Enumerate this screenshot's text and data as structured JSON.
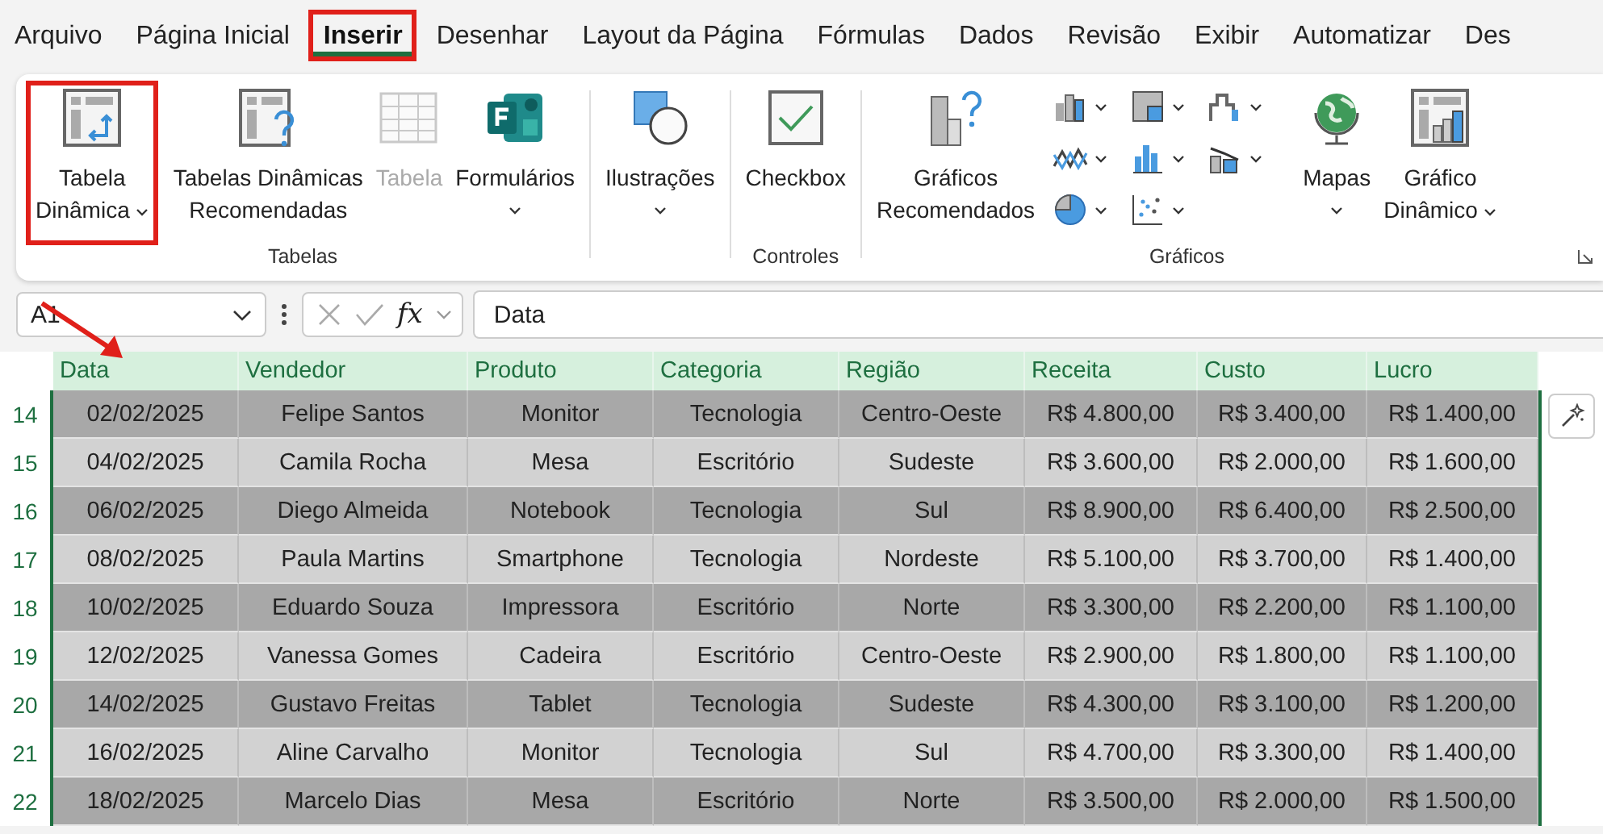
{
  "tabs": [
    {
      "label": "Arquivo",
      "selected": false,
      "highlighted": false
    },
    {
      "label": "Página Inicial",
      "selected": false,
      "highlighted": false
    },
    {
      "label": "Inserir",
      "selected": true,
      "highlighted": true
    },
    {
      "label": "Desenhar",
      "selected": false,
      "highlighted": false
    },
    {
      "label": "Layout da Página",
      "selected": false,
      "highlighted": false
    },
    {
      "label": "Fórmulas",
      "selected": false,
      "highlighted": false
    },
    {
      "label": "Dados",
      "selected": false,
      "highlighted": false
    },
    {
      "label": "Revisão",
      "selected": false,
      "highlighted": false
    },
    {
      "label": "Exibir",
      "selected": false,
      "highlighted": false
    },
    {
      "label": "Automatizar",
      "selected": false,
      "highlighted": false
    },
    {
      "label": "Des",
      "selected": false,
      "highlighted": false
    }
  ],
  "ribbon": {
    "groups": [
      {
        "label": "Tabelas",
        "buttons": [
          {
            "lines": [
              "Tabela",
              "Dinâmica"
            ],
            "dropdown": true,
            "disabled": false,
            "highlighted": true
          },
          {
            "lines": [
              "Tabelas Dinâmicas",
              "Recomendadas"
            ],
            "dropdown": false,
            "disabled": false,
            "highlighted": false
          },
          {
            "lines": [
              "Tabela"
            ],
            "dropdown": false,
            "disabled": true,
            "highlighted": false
          },
          {
            "lines": [
              "Formulários"
            ],
            "dropdown": true,
            "disabled": false,
            "highlighted": false
          }
        ]
      },
      {
        "buttons": [
          {
            "lines": [
              "Ilustrações"
            ],
            "dropdown": true,
            "disabled": false,
            "highlighted": false
          }
        ]
      },
      {
        "label": "Controles",
        "buttons": [
          {
            "lines": [
              "Checkbox"
            ],
            "dropdown": false,
            "disabled": false,
            "highlighted": false
          }
        ]
      },
      {
        "label": "Gráficos",
        "buttons": [
          {
            "lines": [
              "Gráficos",
              "Recomendados"
            ],
            "dropdown": false,
            "disabled": false,
            "highlighted": false
          },
          {
            "lines": [
              "Mapas"
            ],
            "dropdown": true,
            "disabled": false,
            "highlighted": false
          },
          {
            "lines": [
              "Gráfico",
              "Dinâmico"
            ],
            "dropdown": true,
            "disabled": false,
            "highlighted": false
          }
        ]
      }
    ]
  },
  "formula_bar": {
    "name_box": "A1",
    "fx": "fx",
    "value": "Data"
  },
  "table": {
    "columns": [
      "Data",
      "Vendedor",
      "Produto",
      "Categoria",
      "Região",
      "Receita",
      "Custo",
      "Lucro"
    ],
    "rows": [
      {
        "number": "14",
        "shaded": true,
        "cells": [
          "02/02/2025",
          "Felipe Santos",
          "Monitor",
          "Tecnologia",
          "Centro-Oeste",
          "R$ 4.800,00",
          "R$ 3.400,00",
          "R$ 1.400,00"
        ]
      },
      {
        "number": "15",
        "shaded": false,
        "cells": [
          "04/02/2025",
          "Camila Rocha",
          "Mesa",
          "Escritório",
          "Sudeste",
          "R$ 3.600,00",
          "R$ 2.000,00",
          "R$ 1.600,00"
        ]
      },
      {
        "number": "16",
        "shaded": true,
        "cells": [
          "06/02/2025",
          "Diego Almeida",
          "Notebook",
          "Tecnologia",
          "Sul",
          "R$ 8.900,00",
          "R$ 6.400,00",
          "R$ 2.500,00"
        ]
      },
      {
        "number": "17",
        "shaded": false,
        "cells": [
          "08/02/2025",
          "Paula Martins",
          "Smartphone",
          "Tecnologia",
          "Nordeste",
          "R$ 5.100,00",
          "R$ 3.700,00",
          "R$ 1.400,00"
        ]
      },
      {
        "number": "18",
        "shaded": true,
        "cells": [
          "10/02/2025",
          "Eduardo Souza",
          "Impressora",
          "Escritório",
          "Norte",
          "R$ 3.300,00",
          "R$ 2.200,00",
          "R$ 1.100,00"
        ]
      },
      {
        "number": "19",
        "shaded": false,
        "cells": [
          "12/02/2025",
          "Vanessa Gomes",
          "Cadeira",
          "Escritório",
          "Centro-Oeste",
          "R$ 2.900,00",
          "R$ 1.800,00",
          "R$ 1.100,00"
        ]
      },
      {
        "number": "20",
        "shaded": true,
        "cells": [
          "14/02/2025",
          "Gustavo Freitas",
          "Tablet",
          "Tecnologia",
          "Sudeste",
          "R$ 4.300,00",
          "R$ 3.100,00",
          "R$ 1.200,00"
        ]
      },
      {
        "number": "21",
        "shaded": false,
        "cells": [
          "16/02/2025",
          "Aline Carvalho",
          "Monitor",
          "Tecnologia",
          "Sul",
          "R$ 4.700,00",
          "R$ 3.300,00",
          "R$ 1.400,00"
        ]
      },
      {
        "number": "22",
        "shaded": true,
        "cells": [
          "18/02/2025",
          "Marcelo Dias",
          "Mesa",
          "Escritório",
          "Norte",
          "R$ 3.500,00",
          "R$ 2.000,00",
          "R$ 1.500,00"
        ]
      }
    ]
  }
}
